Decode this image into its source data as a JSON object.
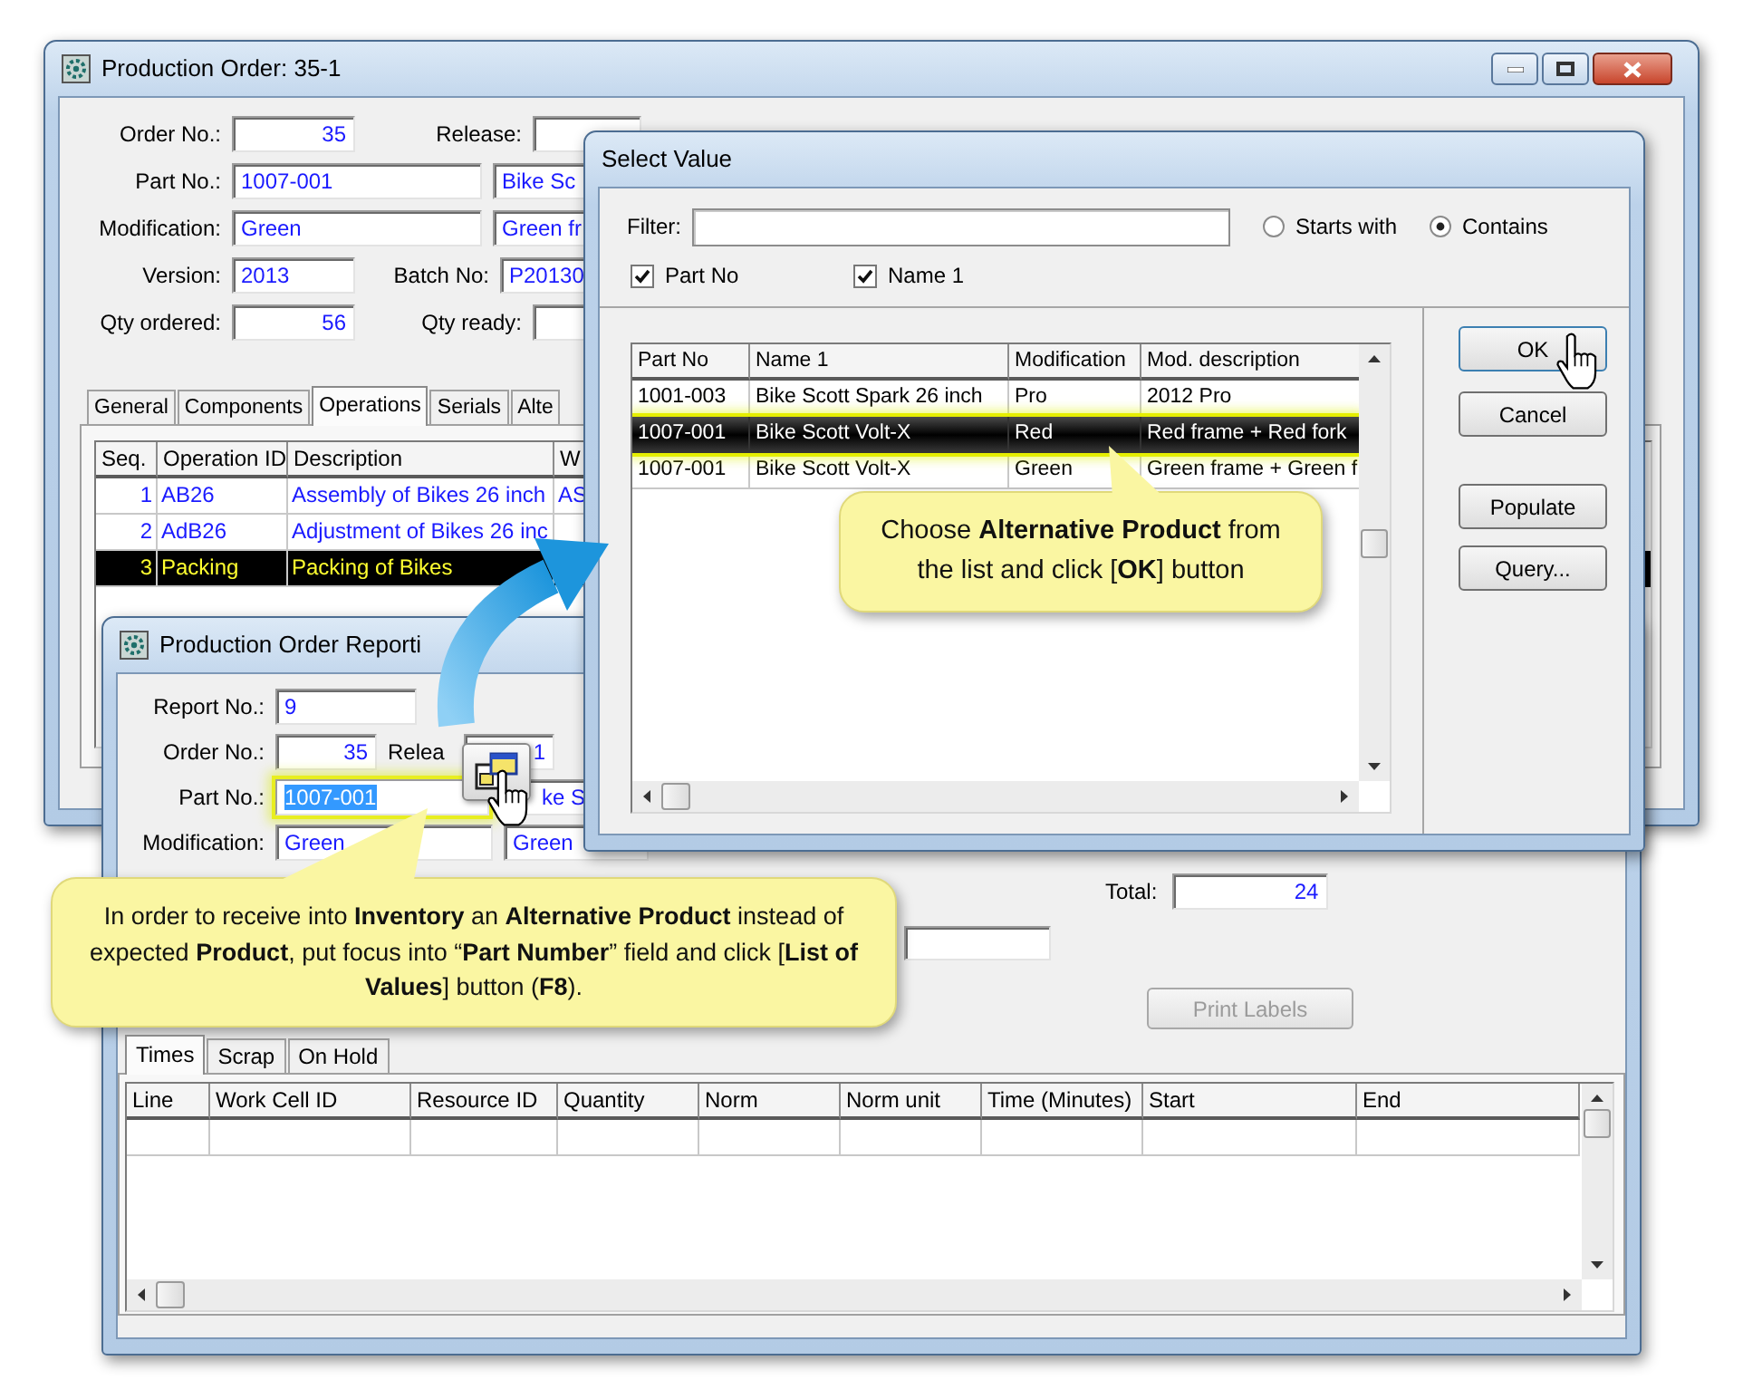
{
  "main_window": {
    "title": "Production Order: 35-1",
    "rows": [
      {
        "items": [
          {
            "kind": "label",
            "text": "Order No.:"
          },
          {
            "kind": "number-field",
            "value": "35"
          },
          {
            "kind": "label",
            "text": "Release:"
          },
          {
            "kind": "field"
          }
        ]
      },
      {
        "items": [
          {
            "kind": "label",
            "text": "Part No.:"
          },
          {
            "kind": "field",
            "value": "1007-001"
          },
          {
            "kind": "field",
            "value": "Bike Sc"
          }
        ]
      },
      {
        "items": [
          {
            "kind": "label",
            "text": "Modification:"
          },
          {
            "kind": "field",
            "value": "Green"
          },
          {
            "kind": "field",
            "value": "Green fr"
          }
        ]
      },
      {
        "items": [
          {
            "kind": "label",
            "text": "Version:"
          },
          {
            "kind": "field",
            "value": "2013"
          },
          {
            "kind": "label",
            "text": "Batch No:"
          },
          {
            "kind": "field",
            "value": "P20130"
          }
        ]
      },
      {
        "items": [
          {
            "kind": "label",
            "text": "Qty ordered:"
          },
          {
            "kind": "number-field",
            "value": "56"
          },
          {
            "kind": "label",
            "text": "Qty ready:"
          },
          {
            "kind": "field"
          }
        ]
      }
    ],
    "tabs": [
      {
        "label": "General",
        "selected": false
      },
      {
        "label": "Components",
        "selected": false
      },
      {
        "label": "Operations",
        "selected": true
      },
      {
        "label": "Serials",
        "selected": false
      },
      {
        "label": "Alte",
        "selected": false
      }
    ],
    "table": {
      "columns": [
        "Seq.",
        "Operation ID",
        "Description",
        "W"
      ],
      "rows": [
        {
          "cells": [
            "1",
            "AB26",
            "Assembly of Bikes 26 inch",
            "AS"
          ],
          "selected": false
        },
        {
          "cells": [
            "2",
            "AdB26",
            "Adjustment of Bikes 26 inc"
          ],
          "selected": false
        },
        {
          "cells": [
            "3",
            "Packing",
            "Packing of Bikes"
          ],
          "selected": true
        }
      ]
    }
  },
  "report_window": {
    "title": "Production Order Reporti",
    "rows": [
      {
        "items": [
          {
            "kind": "label",
            "text": "Report No.:"
          },
          {
            "kind": "field",
            "value": "9"
          }
        ]
      },
      {
        "items": [
          {
            "kind": "label",
            "text": "Order No.:"
          },
          {
            "kind": "number-field",
            "value": "35"
          },
          {
            "kind": "label",
            "text": "Relea"
          },
          {
            "kind": "number-field",
            "value": "1"
          }
        ]
      },
      {
        "items": [
          {
            "kind": "label",
            "text": "Part No.:"
          },
          {
            "kind": "field",
            "value": "1007-001",
            "highlighted": true
          },
          {
            "kind": "field",
            "value": "ke S"
          }
        ]
      },
      {
        "items": [
          {
            "kind": "label",
            "text": "Modification:"
          },
          {
            "kind": "field",
            "value": "Green"
          },
          {
            "kind": "field",
            "value": "Green"
          }
        ]
      }
    ],
    "total": {
      "label": "Total:",
      "value": "24"
    },
    "print_labels_button": {
      "label": "Print Labels",
      "disabled": true
    },
    "tabs": [
      {
        "label": "Times",
        "selected": true
      },
      {
        "label": "Scrap",
        "selected": false
      },
      {
        "label": "On Hold",
        "selected": false
      }
    ],
    "table": {
      "columns": [
        "Line",
        "Work Cell ID",
        "Resource ID",
        "Quantity",
        "Norm",
        "Norm unit",
        "Time (Minutes)",
        "Start",
        "End"
      ]
    }
  },
  "select_value_dialog": {
    "title": "Select Value",
    "filter_label": "Filter:",
    "match_options": [
      {
        "label": "Starts with",
        "selected": false
      },
      {
        "label": "Contains",
        "selected": true
      }
    ],
    "search_columns": [
      {
        "label": "Part No",
        "checked": true
      },
      {
        "label": "Name 1",
        "checked": true
      }
    ],
    "table": {
      "columns": [
        "Part No",
        "Name 1",
        "Modification",
        "Mod. description"
      ],
      "rows": [
        {
          "cells": [
            "1001-003",
            "Bike Scott Spark 26 inch",
            "Pro",
            "2012 Pro"
          ],
          "selected": false
        },
        {
          "cells": [
            "1007-001",
            "Bike Scott Volt-X",
            "Red",
            "Red frame + Red fork"
          ],
          "selected": true
        },
        {
          "cells": [
            "1007-001",
            "Bike Scott Volt-X",
            "Green",
            "Green frame + Green f"
          ],
          "selected": false
        }
      ]
    },
    "buttons": [
      "OK",
      "Cancel",
      "Populate",
      "Query..."
    ]
  },
  "callouts": [
    {
      "text": "Choose **Alternative Product** from the list and click [**OK**] button"
    },
    {
      "text": "In order to receive into **Inventory** an **Alternative Product** instead of expected **Product**, put focus into “**Part Number**” field and click [**List of Values**] button (**F8**)."
    }
  ]
}
